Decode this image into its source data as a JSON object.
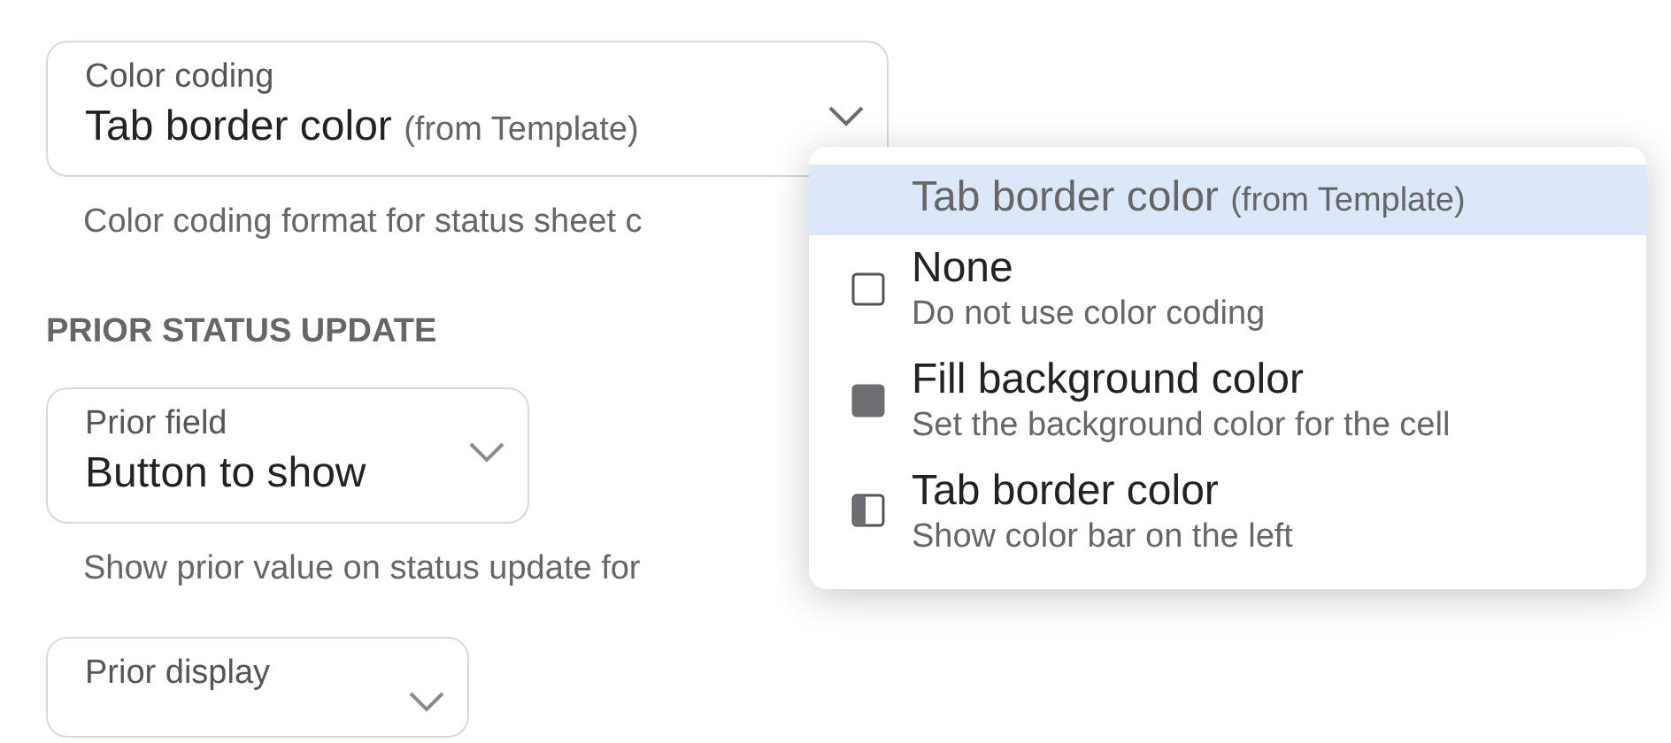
{
  "fields": [
    {
      "label": "Color coding",
      "value": "Tab border color",
      "value_note": "(from Template)",
      "help": "Color coding format for status sheet c",
      "open": true
    },
    {
      "section": "PRIOR STATUS UPDATE"
    },
    {
      "label": "Prior field",
      "value": "Button to show",
      "help": "Show prior value on status update for",
      "open": false
    },
    {
      "label": "Prior display",
      "open": false
    }
  ],
  "menu": {
    "options": [
      {
        "kind": "current",
        "title": "Tab border color",
        "note": "(from Template)",
        "selected": true
      },
      {
        "kind": "none",
        "title": "None",
        "description": "Do not use color coding",
        "selected": false
      },
      {
        "kind": "fill",
        "title": "Fill background color",
        "description": "Set the background color for the cell",
        "selected": false
      },
      {
        "kind": "border",
        "title": "Tab border color",
        "description": "Show color bar on the left",
        "selected": false
      }
    ]
  }
}
